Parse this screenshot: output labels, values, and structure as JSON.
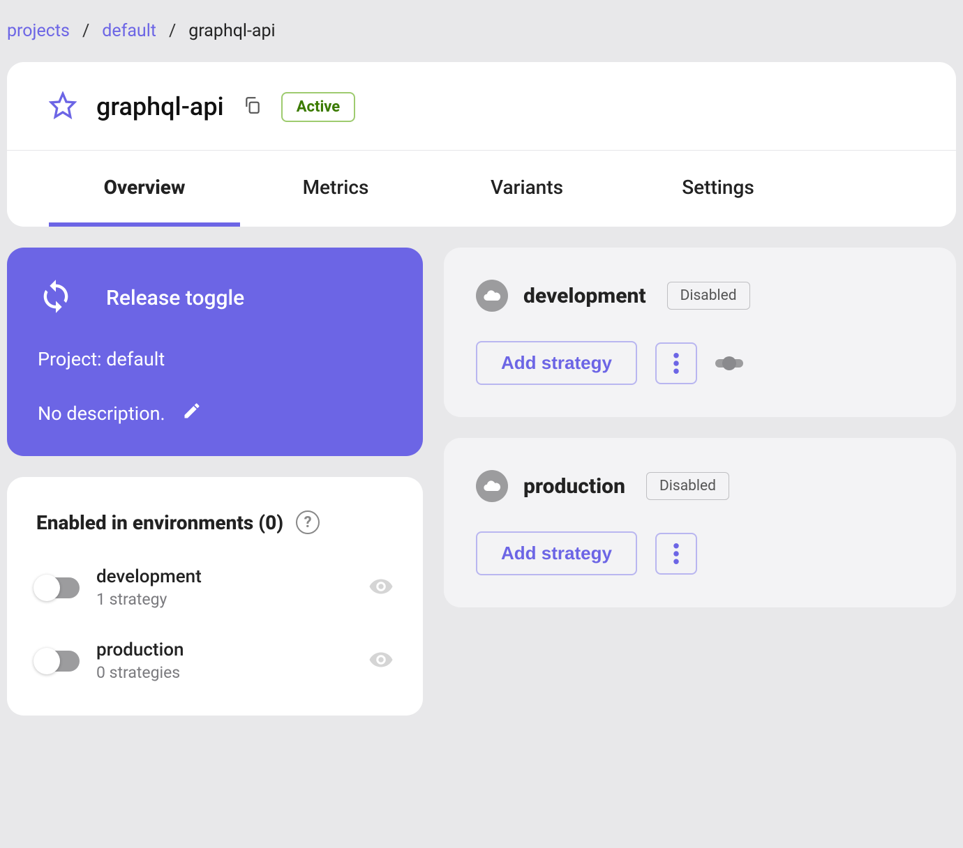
{
  "breadcrumb": {
    "projects": "projects",
    "default": "default",
    "current": "graphql-api"
  },
  "header": {
    "title": "graphql-api",
    "status": "Active"
  },
  "tabs": [
    {
      "label": "Overview",
      "active": true
    },
    {
      "label": "Metrics",
      "active": false
    },
    {
      "label": "Variants",
      "active": false
    },
    {
      "label": "Settings",
      "active": false
    }
  ],
  "release": {
    "type": "Release toggle",
    "project_label": "Project: default",
    "description": "No description."
  },
  "env_section": {
    "title": "Enabled in environments (0)",
    "items": [
      {
        "name": "development",
        "strategies": "1 strategy"
      },
      {
        "name": "production",
        "strategies": "0 strategies"
      }
    ]
  },
  "strategy_cards": [
    {
      "env": "development",
      "status": "Disabled",
      "add_label": "Add strategy",
      "show_toggle": true
    },
    {
      "env": "production",
      "status": "Disabled",
      "add_label": "Add strategy",
      "show_toggle": false
    }
  ]
}
